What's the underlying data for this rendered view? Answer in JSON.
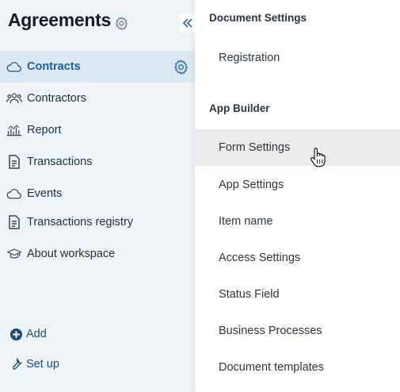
{
  "sidebar": {
    "title": "Agreements",
    "items": [
      {
        "label": "Contracts",
        "icon": "cloud-icon",
        "active": true
      },
      {
        "label": "Contractors",
        "icon": "people-icon"
      },
      {
        "label": "Report",
        "icon": "chart-icon"
      },
      {
        "label": "Transactions",
        "icon": "document-icon"
      },
      {
        "label": "Events",
        "icon": "cloud-icon"
      },
      {
        "label": "Transactions registry",
        "icon": "document-icon"
      },
      {
        "label": "About workspace",
        "icon": "graduation-cap-icon"
      }
    ],
    "add_label": "Add",
    "setup_label": "Set up"
  },
  "menu": {
    "sections": [
      {
        "title": "Document Settings",
        "items": [
          "Registration"
        ]
      },
      {
        "title": "App Builder",
        "items": [
          "Form Settings",
          "App Settings",
          "Item name",
          "Access Settings",
          "Status Field",
          "Business Processes",
          "Document templates"
        ]
      }
    ],
    "hovered_item": "Form Settings"
  },
  "colors": {
    "sidebar_bg": "#eef3f8",
    "active_row": "#dde7f1",
    "accent": "#1a5f9e",
    "menu_hover": "#ececec"
  }
}
